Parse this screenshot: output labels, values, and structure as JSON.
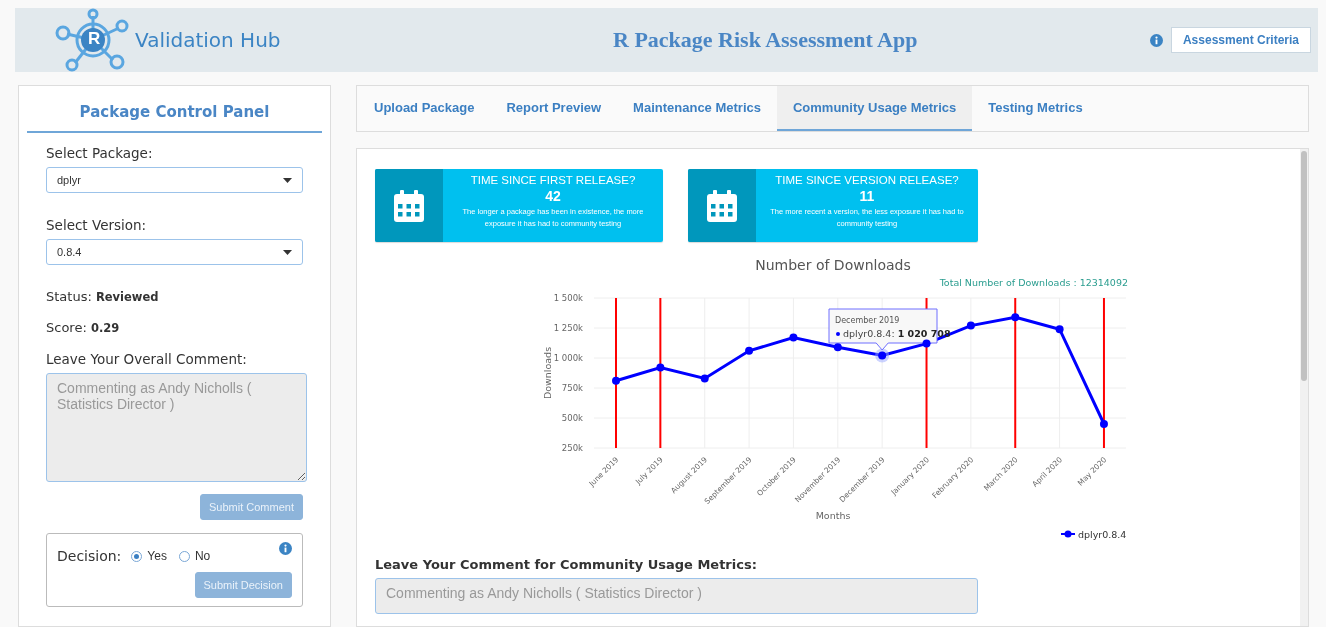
{
  "header": {
    "logo_letter": "R",
    "logo_text": "Validation Hub",
    "title": "R Package Risk Assessment App",
    "criteria_button": "Assessment Criteria"
  },
  "control_panel": {
    "title": "Package Control Panel",
    "package": {
      "label": "Select Package:",
      "value": "dplyr"
    },
    "version": {
      "label": "Select Version:",
      "value": "0.8.4"
    },
    "status": {
      "label": "Status:",
      "value": "Reviewed"
    },
    "score": {
      "label": "Score:",
      "value": "0.29"
    },
    "comment": {
      "label": "Leave Your Overall Comment:",
      "placeholder": "Commenting as Andy Nicholls ( Statistics Director )",
      "disabled": true
    },
    "submit_comment": {
      "label": "Submit Comment",
      "disabled": true
    },
    "decision": {
      "label": "Decision:",
      "options": [
        {
          "label": "Yes",
          "selected": true
        },
        {
          "label": "No",
          "selected": false
        }
      ],
      "submit": {
        "label": "Submit Decision",
        "disabled": true
      }
    }
  },
  "tabs": [
    {
      "label": "Upload Package",
      "selected": false
    },
    {
      "label": "Report Preview",
      "selected": false
    },
    {
      "label": "Maintenance Metrics",
      "selected": false
    },
    {
      "label": "Community Usage Metrics",
      "selected": true
    },
    {
      "label": "Testing Metrics",
      "selected": false
    }
  ],
  "info_boxes": [
    {
      "title": "TIME SINCE FIRST RELEASE?",
      "value": "42",
      "description": "The longer a package has been in existence, the more exposure it has had to community testing"
    },
    {
      "title": "TIME SINCE VERSION RELEASE?",
      "value": "11",
      "description": "The more recent a version, the less exposure it has had to community testing"
    }
  ],
  "chart": {
    "total": "Total Number of Downloads : 12314092",
    "tooltip": {
      "title": "December 2019",
      "series": "dplyr0.8.4:",
      "value": "1 020 708"
    },
    "chart_data": {
      "type": "line",
      "title": "Number of Downloads",
      "xlabel": "Months",
      "ylabel": "Downloads",
      "categories": [
        "June 2019",
        "July 2019",
        "August 2019",
        "September 2019",
        "October 2019",
        "November 2019",
        "December 2019",
        "January 2020",
        "February 2020",
        "March 2020",
        "April 2020",
        "May 2020"
      ],
      "series": [
        {
          "name": "dplyr0.8.4",
          "color": "#0000ff",
          "marker": "circle",
          "values": [
            810000,
            920000,
            830000,
            1060000,
            1170000,
            1090000,
            1020708,
            1120000,
            1270000,
            1340000,
            1240000,
            450000
          ]
        }
      ],
      "grid": true,
      "ylim": [
        250000,
        1500000
      ],
      "yticks": [
        {
          "value": 250000,
          "label": "250k"
        },
        {
          "value": 500000,
          "label": "500k"
        },
        {
          "value": 750000,
          "label": "750k"
        },
        {
          "value": 1000000,
          "label": "1 000k"
        },
        {
          "value": 1250000,
          "label": "1 250k"
        },
        {
          "value": 1500000,
          "label": "1 500k"
        }
      ],
      "annotations": [
        {
          "x": "June 2019"
        },
        {
          "x": "July 2019"
        },
        {
          "x": "January 2020"
        },
        {
          "x": "March 2020"
        },
        {
          "x": "May 2020"
        }
      ]
    }
  },
  "community_comment": {
    "label": "Leave Your Comment for Community Usage Metrics:",
    "placeholder": "Commenting as Andy Nicholls ( Statistics Director )",
    "disabled": true
  }
}
